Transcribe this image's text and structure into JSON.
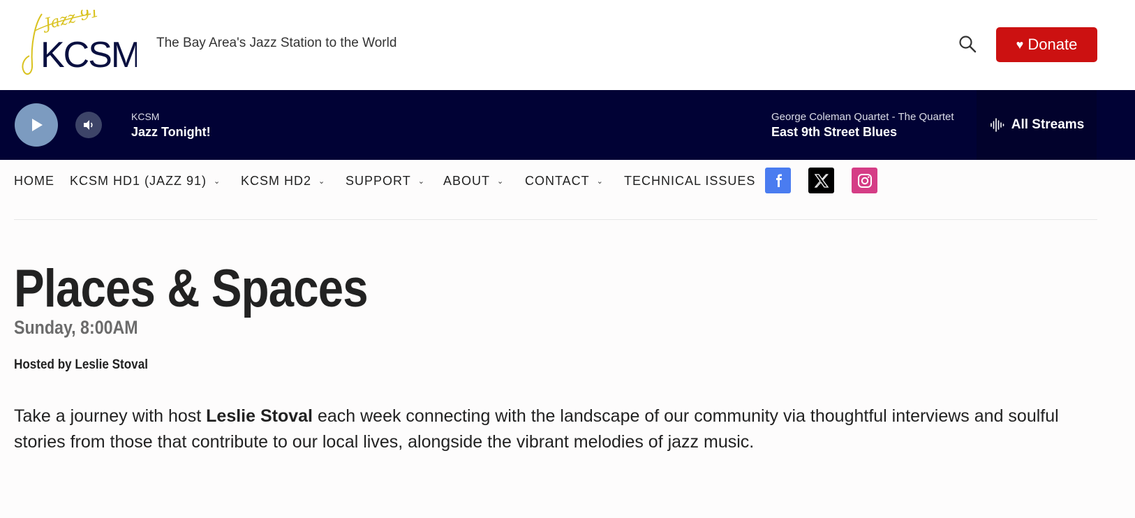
{
  "header": {
    "logo_text": "KCSM",
    "logo_script": "Jazz 91",
    "tagline": "The Bay Area's Jazz Station to the World",
    "donate_label": "Donate",
    "search_icon": "search-icon"
  },
  "player": {
    "station": "KCSM",
    "show": "Jazz Tonight!",
    "artist": "George Coleman Quartet - The Quartet",
    "track": "East 9th Street Blues",
    "streams_label": "All Streams"
  },
  "nav": {
    "items": [
      {
        "label": "HOME",
        "dropdown": false
      },
      {
        "label": "KCSM HD1 (JAZZ 91)",
        "dropdown": true
      },
      {
        "label": "KCSM HD2",
        "dropdown": true
      },
      {
        "label": "SUPPORT",
        "dropdown": true
      },
      {
        "label": "ABOUT",
        "dropdown": true
      },
      {
        "label": "CONTACT",
        "dropdown": true
      },
      {
        "label": "TECHNICAL ISSUES",
        "dropdown": false
      }
    ],
    "social": [
      {
        "name": "facebook-icon",
        "color": "#4a7cf0"
      },
      {
        "name": "x-icon",
        "color": "#000000"
      },
      {
        "name": "instagram-icon",
        "color": "#d53d86"
      }
    ]
  },
  "program": {
    "title": "Places & Spaces",
    "schedule": "Sunday, 8:00AM",
    "host": "Hosted by Leslie Stoval",
    "description_pre": "Take a journey with host ",
    "description_bold": "Leslie Stoval",
    "description_post": " each week connecting with the landscape of our community via thoughtful interviews and soulful stories from those that contribute to our local lives, alongside the vibrant melodies of jazz music."
  },
  "colors": {
    "donate": "#cc1111",
    "player_bg": "#010235",
    "play_button": "#7c9bc0"
  }
}
